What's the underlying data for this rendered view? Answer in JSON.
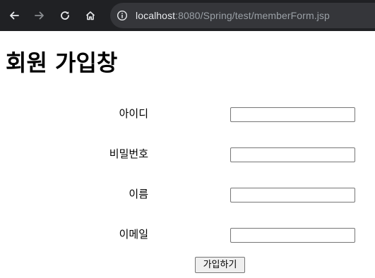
{
  "browser": {
    "url_host": "localhost",
    "url_path": ":8080/Spring/test/memberForm.jsp",
    "icons": [
      "back-arrow-icon",
      "forward-arrow-icon",
      "reload-icon",
      "home-icon",
      "info-icon"
    ]
  },
  "page": {
    "title": "회원 가입창",
    "fields": [
      {
        "label": "아이디",
        "value": ""
      },
      {
        "label": "비밀번호",
        "value": ""
      },
      {
        "label": "이름",
        "value": ""
      },
      {
        "label": "이메일",
        "value": ""
      }
    ],
    "submit_label": "가입하기"
  }
}
